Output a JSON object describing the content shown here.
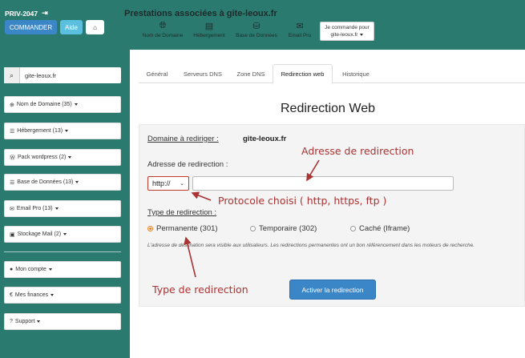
{
  "header": {
    "account_id": "PRIV-2047",
    "commander_label": "COMMANDER",
    "aide_label": "Aide",
    "site_title": "Prestations associées à gite-leoux.fr",
    "services": [
      {
        "icon": "globe-icon",
        "label": "Nom de Domaine"
      },
      {
        "icon": "server-icon",
        "label": "Hébergement"
      },
      {
        "icon": "database-icon",
        "label": "Base de Données"
      },
      {
        "icon": "envelope-icon",
        "label": "Email Pro"
      }
    ],
    "commande_line1": "Je commande pour",
    "commande_line2": "gite-leoux.fr"
  },
  "sidebar": {
    "search_value": "gite-leoux.fr",
    "items": [
      {
        "label": "Nom de Domaine (35)",
        "icon": "globe-icon"
      },
      {
        "label": "Hébergement (13)",
        "icon": "list-icon"
      },
      {
        "label": "Pack wordpress (2)",
        "icon": "wordpress-icon"
      },
      {
        "label": "Base de Données (13)",
        "icon": "list-icon"
      },
      {
        "label": "Email Pro (13)",
        "icon": "envelope-icon"
      },
      {
        "label": "Stockage Mail (2)",
        "icon": "box-icon"
      },
      {
        "label": "Mon compte",
        "icon": "user-icon"
      },
      {
        "label": "Mes finances",
        "icon": "euro-icon"
      },
      {
        "label": "Support",
        "icon": "question-icon"
      }
    ]
  },
  "tabs": [
    {
      "label": "Général"
    },
    {
      "label": "Serveurs DNS"
    },
    {
      "label": "Zone DNS"
    },
    {
      "label": "Redirection web"
    },
    {
      "label": "Historique"
    }
  ],
  "main": {
    "title": "Redirection Web",
    "domain_label": "Domaine à rediriger :",
    "domain_value": "gite-leoux.fr",
    "address_label": "Adresse de redirection :",
    "protocol_value": "http://",
    "url_value": "",
    "type_label": "Type de redirection :",
    "radio_options": [
      {
        "label": "Permanente (301)",
        "selected": true
      },
      {
        "label": "Temporaire (302)",
        "selected": false
      },
      {
        "label": "Caché (Iframe)",
        "selected": false
      }
    ],
    "help_text": "L'adresse de destination sera visible aux utilisateurs. Les redirections permanentes ont un bon référencement dans les moteurs de recherche.",
    "activate_label": "Activer la redirection"
  },
  "annotations": {
    "address": "Adresse de redirection",
    "protocol": "Protocole choisi ( http, https, ftp )",
    "type": "Type de redirection"
  },
  "colors": {
    "teal": "#2b7a6f",
    "primary": "#3b86c6",
    "annotation": "#aa3333",
    "radio_selected": "#e67e22"
  }
}
